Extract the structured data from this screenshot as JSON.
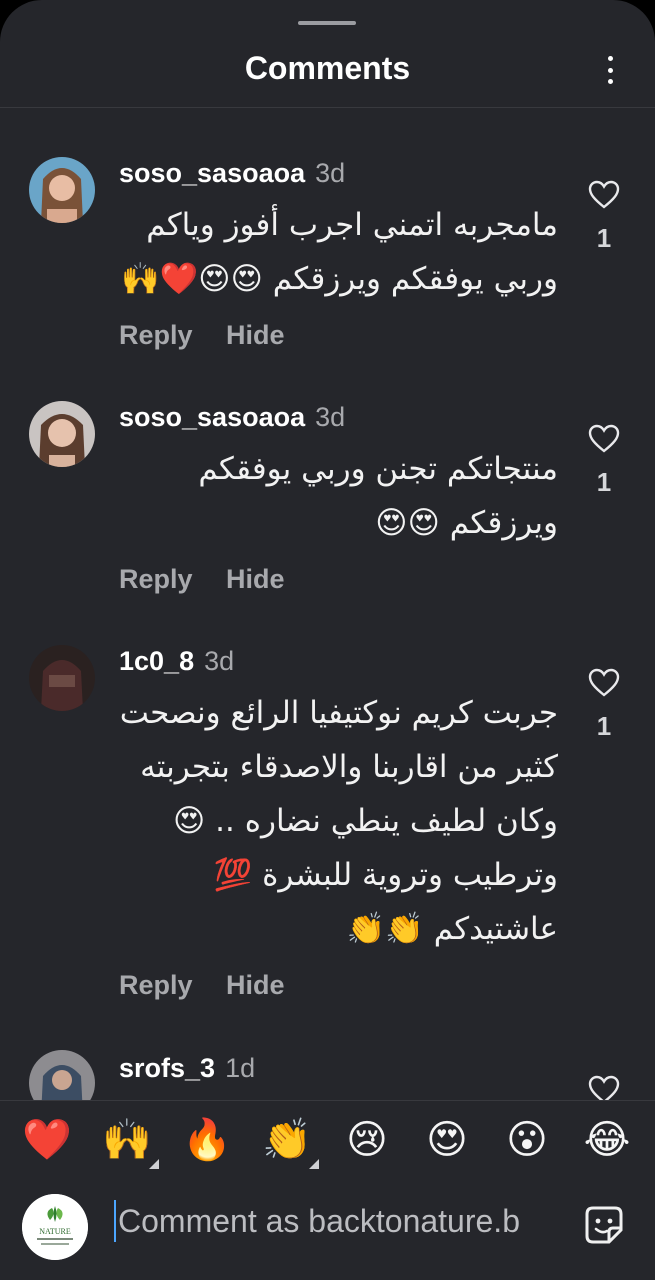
{
  "header": {
    "title": "Comments"
  },
  "comments": [
    {
      "username": "soso_sasoaoa",
      "time": "3d",
      "lines": [
        "مامجربه اتمني اجرب أفوز وياكم",
        "وربي يوفقكم ويرزقكم 😍😍❤️🙌"
      ],
      "likes": "1",
      "reply_label": "Reply",
      "hide_label": "Hide"
    },
    {
      "username": "soso_sasoaoa",
      "time": "3d",
      "lines": [
        "منتجاتكم تجنن وربي يوفقكم",
        "ويرزقكم 😍😍"
      ],
      "likes": "1",
      "reply_label": "Reply",
      "hide_label": "Hide"
    },
    {
      "username": "1c0_8",
      "time": "3d",
      "lines": [
        "جربت كريم نوكتيفيا الرائع ونصحت",
        "كثير من اقاربنا والاصدقاء  بتجربته",
        "وكان لطيف ينطي نضاره .. 😍",
        "وترطيب وتروية للبشرة 💯",
        "عاشتيدكم 👏👏"
      ],
      "likes": "1",
      "reply_label": "Reply",
      "hide_label": "Hide"
    },
    {
      "username": "srofs_3",
      "time": "1d",
      "lines": [],
      "likes": "",
      "reply_label": "",
      "hide_label": ""
    }
  ],
  "reactions": [
    "❤️",
    "🙌",
    "🔥",
    "👏",
    "😢",
    "😍",
    "😮",
    "😂"
  ],
  "compose": {
    "placeholder": "Comment as backtonature.b"
  },
  "colors": {
    "background": "#25262b",
    "text": "#f5f5f5",
    "muted": "#a8a9ad",
    "cursor": "#4ca6ff"
  }
}
